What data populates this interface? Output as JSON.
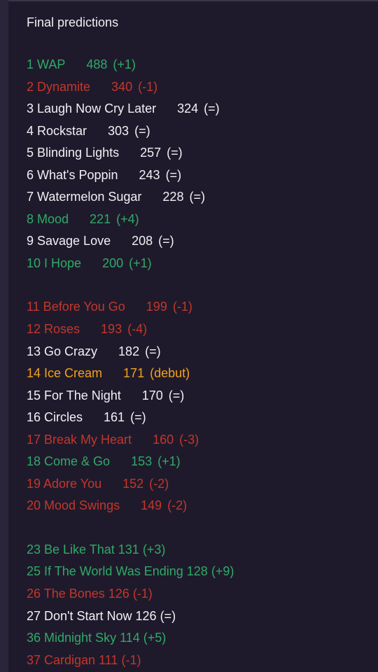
{
  "title": "Final predictions",
  "colors": {
    "up": "#2faa68",
    "down": "#c2372c",
    "same": "#f2f0f5",
    "debut": "#f0a21c",
    "background": "#1f1a2b"
  },
  "groups": [
    [
      {
        "rank": "1",
        "song": "WAP",
        "points": "488",
        "change": "(+1)",
        "status": "up"
      },
      {
        "rank": "2",
        "song": "Dynamite",
        "points": "340",
        "change": "(-1)",
        "status": "down"
      },
      {
        "rank": "3",
        "song": "Laugh Now Cry Later",
        "points": "324",
        "change": "(=)",
        "status": "same"
      },
      {
        "rank": "4",
        "song": "Rockstar",
        "points": "303",
        "change": "(=)",
        "status": "same"
      },
      {
        "rank": "5",
        "song": "Blinding Lights",
        "points": "257",
        "change": "(=)",
        "status": "same"
      },
      {
        "rank": "6",
        "song": "What's Poppin",
        "points": "243",
        "change": "(=)",
        "status": "same"
      },
      {
        "rank": "7",
        "song": "Watermelon Sugar",
        "points": "228",
        "change": "(=)",
        "status": "same"
      },
      {
        "rank": "8",
        "song": "Mood",
        "points": "221",
        "change": "(+4)",
        "status": "up"
      },
      {
        "rank": "9",
        "song": "Savage Love",
        "points": "208",
        "change": "(=)",
        "status": "same"
      },
      {
        "rank": "10",
        "song": "I Hope",
        "points": "200",
        "change": "(+1)",
        "status": "up"
      }
    ],
    [
      {
        "rank": "11",
        "song": "Before You Go",
        "points": "199",
        "change": "(-1)",
        "status": "down"
      },
      {
        "rank": "12",
        "song": "Roses",
        "points": "193",
        "change": "(-4)",
        "status": "down"
      },
      {
        "rank": "13",
        "song": "Go Crazy",
        "points": "182",
        "change": "(=)",
        "status": "same"
      },
      {
        "rank": "14",
        "song": "Ice Cream",
        "points": "171",
        "change": "(debut)",
        "status": "new"
      },
      {
        "rank": "15",
        "song": "For The Night",
        "points": "170",
        "change": "(=)",
        "status": "same"
      },
      {
        "rank": "16",
        "song": "Circles",
        "points": "161",
        "change": "(=)",
        "status": "same"
      },
      {
        "rank": "17",
        "song": "Break My Heart",
        "points": "160",
        "change": "(-3)",
        "status": "down"
      },
      {
        "rank": "18",
        "song": "Come & Go",
        "points": "153",
        "change": "(+1)",
        "status": "up"
      },
      {
        "rank": "19",
        "song": "Adore You",
        "points": "152",
        "change": "(-2)",
        "status": "down"
      },
      {
        "rank": "20",
        "song": "Mood Swings",
        "points": "149",
        "change": "(-2)",
        "status": "down"
      }
    ],
    [
      {
        "rank": "23",
        "song": "Be Like That",
        "points": "131",
        "change": "(+3)",
        "status": "up",
        "compact": true
      },
      {
        "rank": "25",
        "song": "If The World Was Ending",
        "points": "128",
        "change": "(+9)",
        "status": "up",
        "compact": true
      },
      {
        "rank": "26",
        "song": "The Bones",
        "points": "126",
        "change": "(-1)",
        "status": "down",
        "compact": true
      },
      {
        "rank": "27",
        "song": "Don't Start Now",
        "points": "126",
        "change": "(=)",
        "status": "same",
        "compact": true
      },
      {
        "rank": "36",
        "song": "Midnight Sky",
        "points": "114",
        "change": "(+5)",
        "status": "up",
        "compact": true
      },
      {
        "rank": "37",
        "song": "Cardigan",
        "points": "111",
        "change": "(-1)",
        "status": "down",
        "compact": true
      }
    ]
  ]
}
